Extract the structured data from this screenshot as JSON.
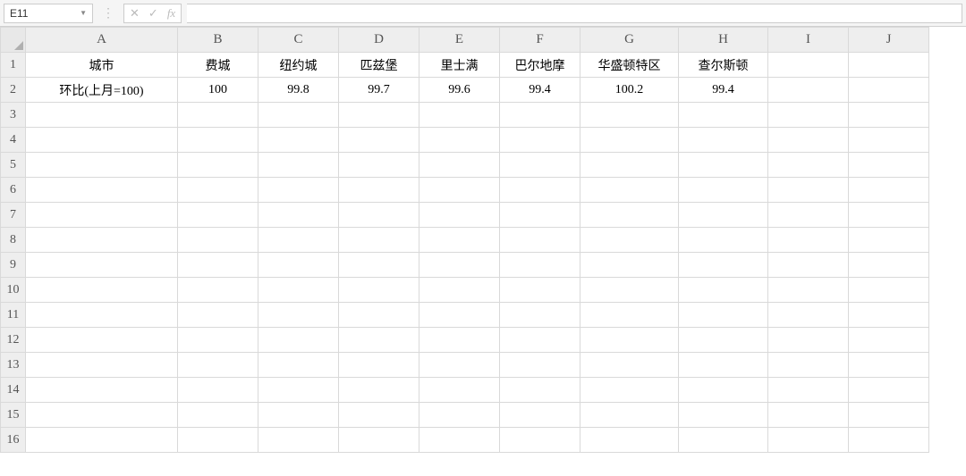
{
  "formula_bar": {
    "cell_reference": "E11",
    "fx_label": "fx",
    "formula_value": ""
  },
  "columns": [
    "A",
    "B",
    "C",
    "D",
    "E",
    "F",
    "G",
    "H",
    "I",
    "J"
  ],
  "row_count": 16,
  "col_classes": {
    "A": "col-A",
    "B": "col-std",
    "C": "col-std",
    "D": "col-std",
    "E": "col-std",
    "F": "col-std",
    "G": "col-G",
    "H": "col-H",
    "I": "col-std",
    "J": "col-std"
  },
  "cells": {
    "A1": "城市",
    "B1": "费城",
    "C1": "纽约城",
    "D1": "匹兹堡",
    "E1": "里士满",
    "F1": "巴尔地摩",
    "G1": "华盛顿特区",
    "H1": "查尔斯顿",
    "A2": "环比(上月=100)",
    "B2": "100",
    "C2": "99.8",
    "D2": "99.7",
    "E2": "99.6",
    "F2": "99.4",
    "G2": "100.2",
    "H2": "99.4"
  },
  "chart_data": {
    "type": "table",
    "title": "",
    "categories": [
      "费城",
      "纽约城",
      "匹兹堡",
      "里士满",
      "巴尔地摩",
      "华盛顿特区",
      "查尔斯顿"
    ],
    "series": [
      {
        "name": "环比(上月=100)",
        "values": [
          100,
          99.8,
          99.7,
          99.6,
          99.4,
          100.2,
          99.4
        ]
      }
    ]
  }
}
